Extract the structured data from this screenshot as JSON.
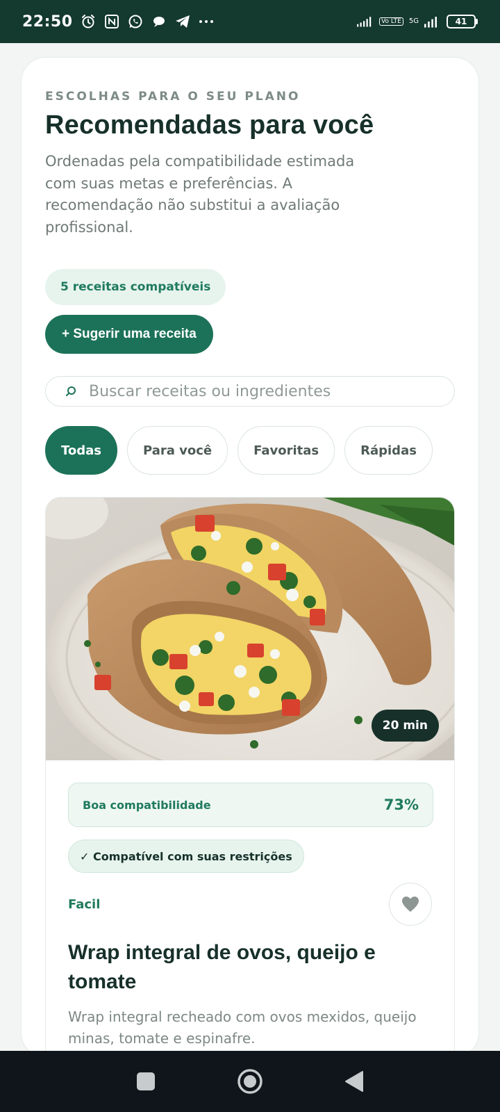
{
  "status_bar": {
    "time": "22:50",
    "battery": "41",
    "network_label": "Vo LTE",
    "network_5g": "5G"
  },
  "header": {
    "eyebrow": "ESCOLHAS PARA O SEU PLANO",
    "title": "Recomendadas para você",
    "description": "Ordenadas pela compatibilidade estimada com suas metas e preferências. A recomendação não substitui a avaliação profissional."
  },
  "count_label": "5 receitas compatíveis",
  "suggest_button": "+ Sugerir uma receita",
  "search": {
    "placeholder": "Buscar receitas ou ingredientes",
    "value": ""
  },
  "filters": [
    {
      "label": "Todas",
      "active": true
    },
    {
      "label": "Para você",
      "active": false
    },
    {
      "label": "Favoritas",
      "active": false
    },
    {
      "label": "Rápidas",
      "active": false
    }
  ],
  "recipe": {
    "time": "20 min",
    "compat_label": "Boa compatibilidade",
    "compat_value": "73%",
    "compat_percent": 73,
    "restriction": "✓ Compatível com suas restrições",
    "difficulty": "Facil",
    "title": "Wrap integral de ovos, queijo e tomate",
    "description": "Wrap integral recheado com ovos mexidos, queijo minas, tomate e espinafre."
  },
  "colors": {
    "primary": "#1c7258",
    "status_bar": "#14392f",
    "title": "#17302a"
  }
}
